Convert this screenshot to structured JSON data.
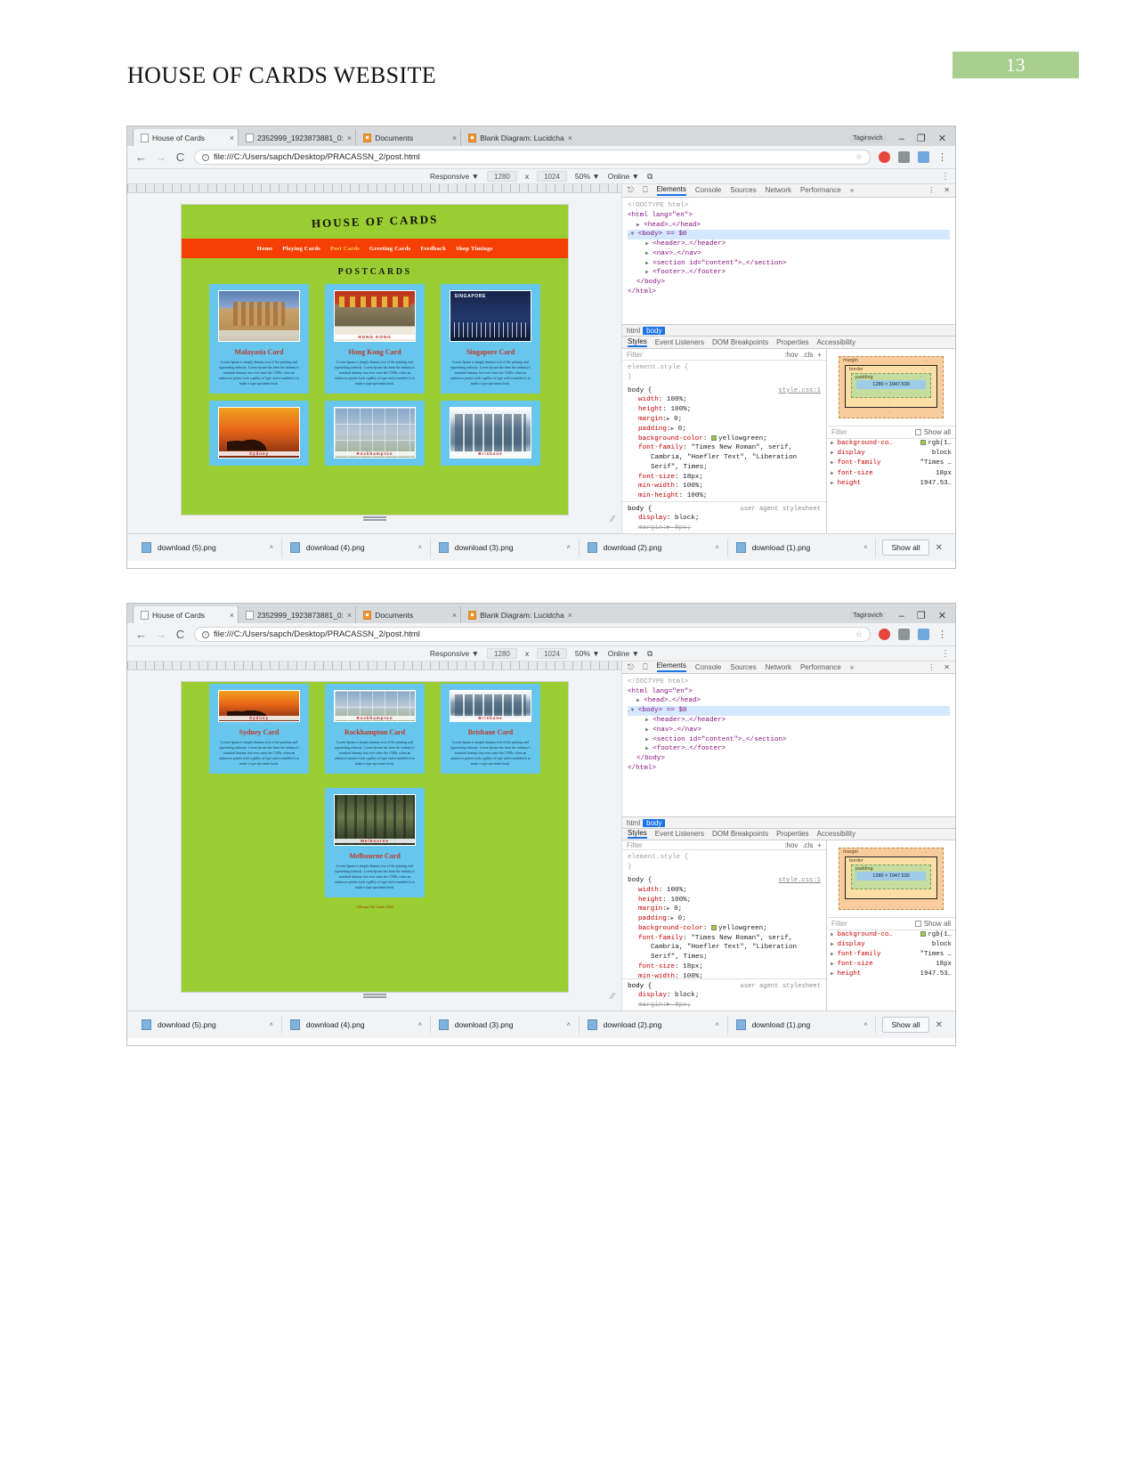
{
  "document": {
    "heading": "HOUSE OF CARDS WEBSITE",
    "page_number": "13"
  },
  "browser": {
    "tabs": [
      {
        "title": "House of Cards",
        "close": "×",
        "favicon": "page-icon",
        "active": true
      },
      {
        "title": "2352999_1923873881_0:",
        "close": "×",
        "favicon": "page-icon",
        "active": false
      },
      {
        "title": "Documents",
        "close": "×",
        "favicon": "drive-icon",
        "active": false
      },
      {
        "title": "Blank Diagram: Lucidcha",
        "close": "×",
        "favicon": "lucid-icon",
        "active": false
      }
    ],
    "window_controls": {
      "badge": "Tagirovich",
      "minimize": "–",
      "maximize": "❐",
      "close": "✕"
    },
    "nav": {
      "back": "←",
      "forward": "→",
      "reload": "C",
      "info": "ⓘ",
      "star": "☆",
      "kebab": "⋮"
    },
    "url": "file:///C:/Users/sapch/Desktop/PRACASSN_2/post.html",
    "extensions": [
      "opera-icon",
      "cast-icon",
      "screen-icon"
    ],
    "device_toolbar": {
      "device": "Responsive",
      "width": "1280",
      "separator": "x",
      "height": "1024",
      "zoom": "50%",
      "throttling": "Online",
      "caret": "▼",
      "rotate": "⧉",
      "kebab": "⋮"
    }
  },
  "site": {
    "title": "HOUSE OF CARDS",
    "nav": [
      {
        "label": "Home",
        "active": false
      },
      {
        "label": "Playing Cards",
        "active": false
      },
      {
        "label": "Post Cards",
        "active": true
      },
      {
        "label": "Greeting Cards",
        "active": false
      },
      {
        "label": "Feedback",
        "active": false
      },
      {
        "label": "Shop Timings",
        "active": false
      }
    ],
    "section_title": "POSTCARDS",
    "body_text": "Lorem Ipsum is simply dummy text of the printing and typesetting industry. Lorem Ipsum has been the industry's standard dummy text ever since the 1500s, when an unknown printer took a galley of type and scrambled it to make a type specimen book.",
    "cards_row1": [
      {
        "title": "Malayasia Card",
        "art": "art-malaysia",
        "caption": ""
      },
      {
        "title": "Hong Kong Card",
        "art": "art-hk",
        "caption": "HONG KONG"
      },
      {
        "title": "Singapore Card",
        "art": "art-sg",
        "caption": "SINGAPORE"
      }
    ],
    "cards_row2": [
      {
        "title": "Sydney Card",
        "art": "art-sydney",
        "caption": "Sydney"
      },
      {
        "title": "Rockhampton Card",
        "art": "art-rock",
        "caption": "Rockhampton"
      },
      {
        "title": "Brisbane Card",
        "art": "art-bris",
        "caption": "Brisbane"
      }
    ],
    "card_melbourne": {
      "title": "Melbourne Card",
      "art": "art-melb",
      "caption": "Melbourne"
    },
    "footer": "©House Of Cards 2023"
  },
  "devtools": {
    "toolbar": {
      "inspect_icon": "inspect-icon",
      "device_icon": "device-toggle-icon",
      "tabs": [
        "Elements",
        "Console",
        "Sources",
        "Network",
        "Performance"
      ],
      "overflow": "»",
      "kebab": "⋮",
      "close": "✕",
      "selected_tab": "Elements"
    },
    "dom": {
      "doctype": "<!DOCTYPE html>",
      "html_open": "<html lang=\"en\">",
      "head": "<head>…</head>",
      "body_selected": "<body> == $0",
      "children": [
        "<header>…</header>",
        "<nav>…</nav>",
        "<section id=\"content\">…</section>",
        "<footer>…</footer>"
      ],
      "body_close": "</body>",
      "html_close": "</html>"
    },
    "breadcrumbs": [
      "html",
      "body"
    ],
    "breadcrumb_selected": "body",
    "subtabs": [
      "Styles",
      "Event Listeners",
      "DOM Breakpoints",
      "Properties",
      "Accessibility"
    ],
    "subtab_selected": "Styles",
    "styles": {
      "filter_placeholder": "Filter",
      "hov": ":hov",
      "cls": ".cls",
      "plus": "+",
      "element_style": "element.style {",
      "element_style_close": "}",
      "body_rule": "body {",
      "source": "style.css:1",
      "declarations": [
        {
          "prop": "width",
          "value": "100%;"
        },
        {
          "prop": "height",
          "value": "100%;"
        },
        {
          "prop": "margin",
          "value": "0;",
          "expandable": true
        },
        {
          "prop": "padding",
          "value": "0;",
          "expandable": true
        },
        {
          "prop": "background-color",
          "value": "yellowgreen;",
          "swatch": "#9acd32"
        },
        {
          "prop": "font-family",
          "value": "\"Times New Roman\", serif,"
        },
        {
          "prop": "",
          "value": "Cambria, \"Hoefler Text\", \"Liberation"
        },
        {
          "prop": "",
          "value": "Serif\", Times;"
        },
        {
          "prop": "font-size",
          "value": "18px;"
        },
        {
          "prop": "min-width",
          "value": "100%;"
        },
        {
          "prop": "min-height",
          "value": "100%;"
        }
      ],
      "close_brace": "}",
      "ua_rule": "body {",
      "ua_label": "user agent stylesheet",
      "ua_declarations": [
        {
          "prop": "display",
          "value": "block;"
        },
        {
          "prop": "margin",
          "value": "8px;",
          "struck": true
        }
      ]
    },
    "box_model": {
      "margin_label": "margin",
      "border_label": "border",
      "padding_label": "padding",
      "content": "1280 × 1947.530",
      "dash": "-"
    },
    "computed": {
      "filter_placeholder": "Filter",
      "show_all": "Show all",
      "rows": [
        {
          "prop": "background-co…",
          "value": "rgb(1…",
          "swatch": "#9acd32"
        },
        {
          "prop": "display",
          "value": "block"
        },
        {
          "prop": "font-family",
          "value": "\"Times …"
        },
        {
          "prop": "font-size",
          "value": "18px"
        },
        {
          "prop": "height",
          "value": "1947.53…"
        }
      ]
    }
  },
  "downloads": {
    "items": [
      {
        "name": "download (5).png",
        "caret": "˄"
      },
      {
        "name": "download (4).png",
        "caret": "˄"
      },
      {
        "name": "download (3).png",
        "caret": "˄"
      },
      {
        "name": "download (2).png",
        "caret": "˄"
      },
      {
        "name": "download (1).png",
        "caret": "˄"
      }
    ],
    "show_all": "Show all",
    "close": "✕"
  }
}
